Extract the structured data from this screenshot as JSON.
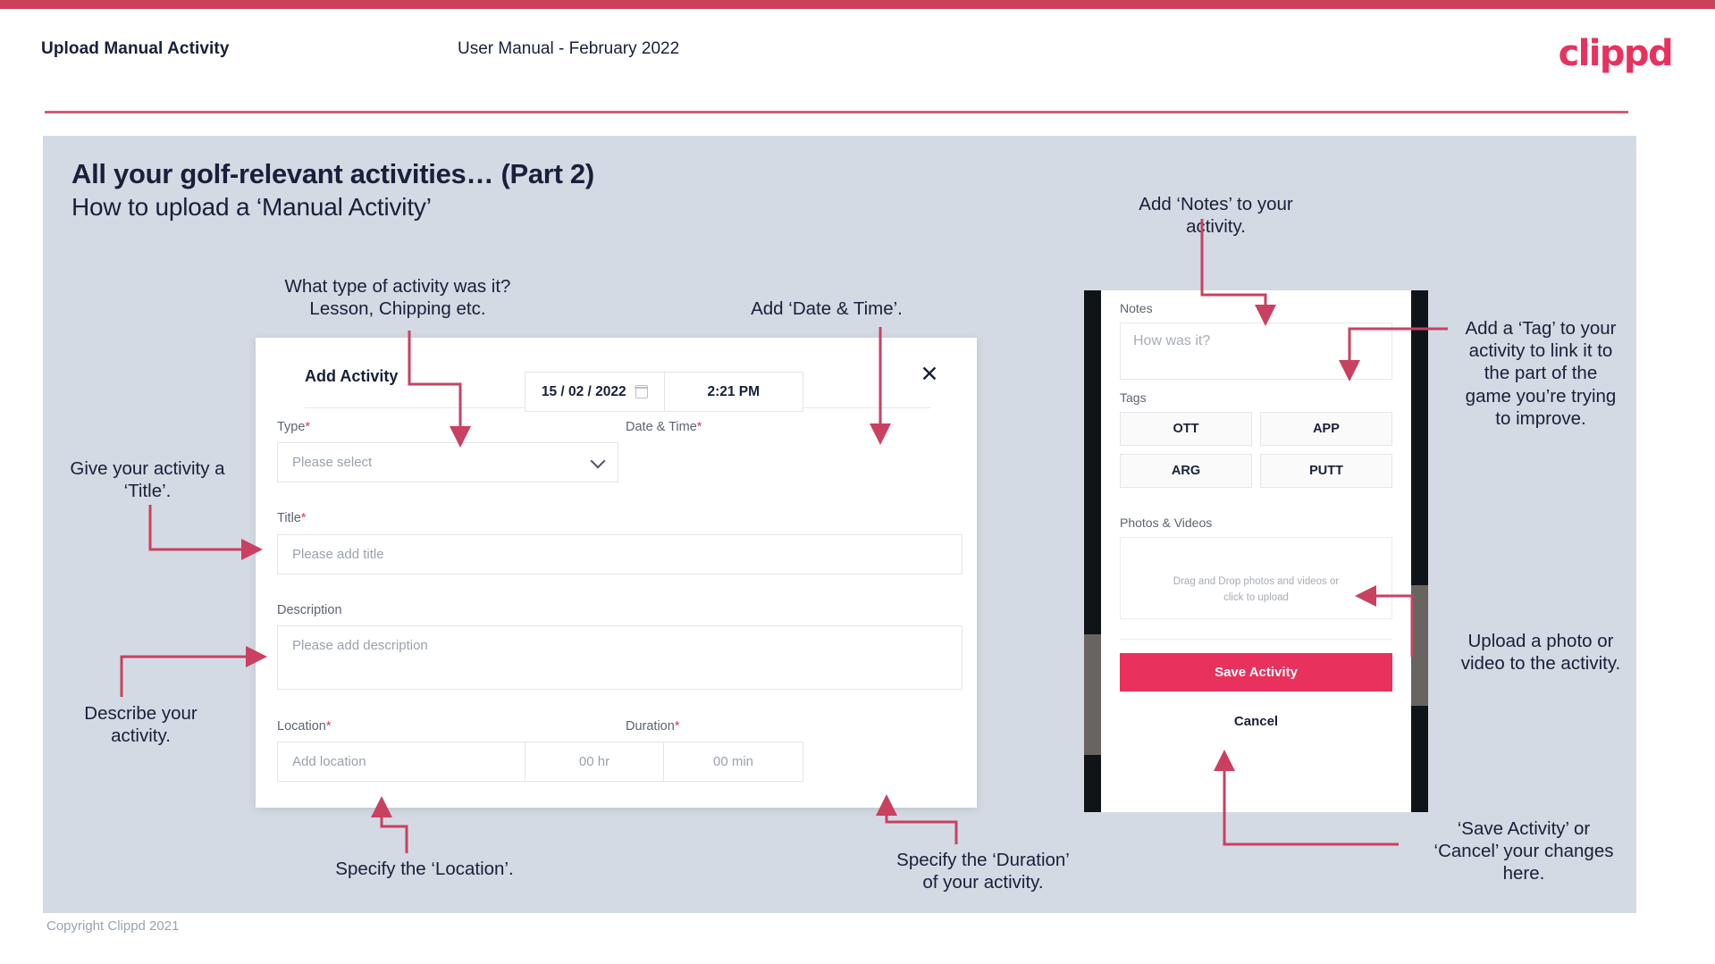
{
  "header": {
    "title": "Upload Manual Activity",
    "subtitle": "User Manual - February 2022",
    "logo": "clippd"
  },
  "slide": {
    "title": "All your golf-relevant activities… (Part 2)",
    "subtitle": "How to upload a ‘Manual Activity’"
  },
  "footer": {
    "copyright": "Copyright Clippd 2021"
  },
  "dialog": {
    "title": "Add Activity",
    "close_icon": "close-icon",
    "fields": {
      "type": {
        "label": "Type",
        "required": "*",
        "placeholder": "Please select"
      },
      "datetime": {
        "label": "Date & Time",
        "required": "*",
        "date": "15 /  02  / 2022",
        "time": "2:21 PM"
      },
      "title": {
        "label": "Title",
        "required": "*",
        "placeholder": "Please add title"
      },
      "description": {
        "label": "Description",
        "required": "",
        "placeholder": "Please add description"
      },
      "location": {
        "label": "Location",
        "required": "*",
        "placeholder": "Add location"
      },
      "duration": {
        "label": "Duration",
        "required": "*",
        "hours": "00 hr",
        "minutes": "00 min"
      }
    }
  },
  "phone": {
    "notes": {
      "label": "Notes",
      "placeholder": "How was it?"
    },
    "tags": {
      "label": "Tags",
      "items": [
        "OTT",
        "APP",
        "ARG",
        "PUTT"
      ]
    },
    "photos": {
      "label": "Photos & Videos",
      "dropzone_line1": "Drag and Drop photos and videos or",
      "dropzone_line2": "click to upload",
      "icon": "add-image-icon"
    },
    "save_label": "Save Activity",
    "cancel_label": "Cancel"
  },
  "annotations": {
    "type": "What type of activity was it?\nLesson, Chipping etc.",
    "datetime": "Add ‘Date & Time’.",
    "title": "Give your activity a\n‘Title’.",
    "description": "Describe your\nactivity.",
    "location": "Specify the ‘Location’.",
    "duration": "Specify the ‘Duration’\nof your activity.",
    "notes": "Add ‘Notes’ to your\nactivity.",
    "tags": "Add a ‘Tag’ to your\nactivity to link it to\nthe part of the\ngame you’re trying\nto improve.",
    "photos": "Upload a photo or\nvideo to the activity.",
    "save": "‘Save Activity’ or\n‘Cancel’ your changes\nhere."
  },
  "colors": {
    "brand_pink": "#e8315c",
    "top_bar": "#cc4159",
    "slide_bg": "#d3dae3",
    "text_dark": "#18203a",
    "arrow": "#c94060"
  }
}
